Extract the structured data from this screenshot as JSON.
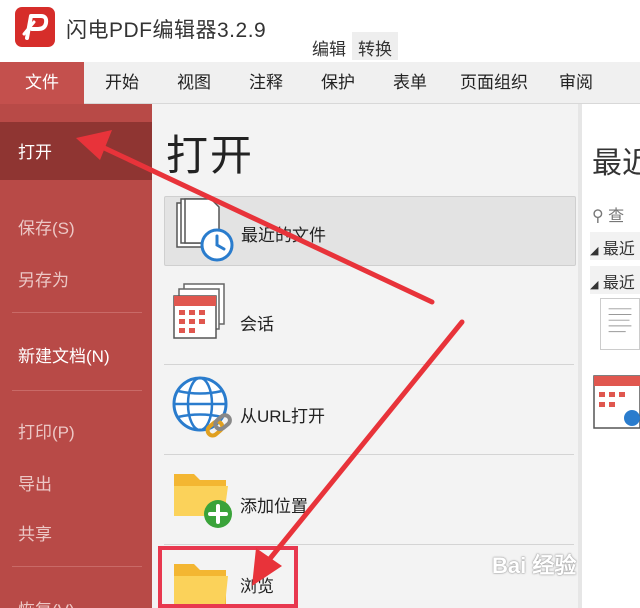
{
  "app": {
    "title": "闪电PDF编辑器3.2.9",
    "quick_tabs": [
      "编辑",
      "转换"
    ]
  },
  "menu": [
    "文件",
    "开始",
    "视图",
    "注释",
    "保护",
    "表单",
    "页面组织",
    "审阅"
  ],
  "sidebar": {
    "items": [
      {
        "label": "打开",
        "state": "active"
      },
      {
        "label": "保存(S)",
        "state": "disabled"
      },
      {
        "label": "另存为",
        "state": "disabled"
      },
      {
        "label": "新建文档(N)",
        "state": "normal"
      },
      {
        "label": "打印(P)",
        "state": "disabled"
      },
      {
        "label": "导出",
        "state": "disabled"
      },
      {
        "label": "共享",
        "state": "disabled"
      },
      {
        "label": "恢复(V)",
        "state": "disabled"
      }
    ]
  },
  "open_panel": {
    "title": "打开",
    "items": [
      {
        "label": "最近的文件",
        "icon": "recent-files-clock-icon"
      },
      {
        "label": "会话",
        "icon": "session-calendar-icon"
      },
      {
        "label": "从URL打开",
        "icon": "globe-link-icon"
      },
      {
        "label": "添加位置",
        "icon": "folder-add-icon"
      },
      {
        "label": "浏览",
        "icon": "folder-browse-icon"
      }
    ]
  },
  "right_panel": {
    "title": "最近",
    "search": "查",
    "groups": [
      "最近",
      "最近"
    ]
  },
  "watermark": "Bai 经验",
  "colors": {
    "accent": "#c4504d",
    "sidebar": "#b84a47",
    "sidebar_active": "#8f3532",
    "arrow": "#e8333a",
    "highlight_box": "#e8384f"
  }
}
